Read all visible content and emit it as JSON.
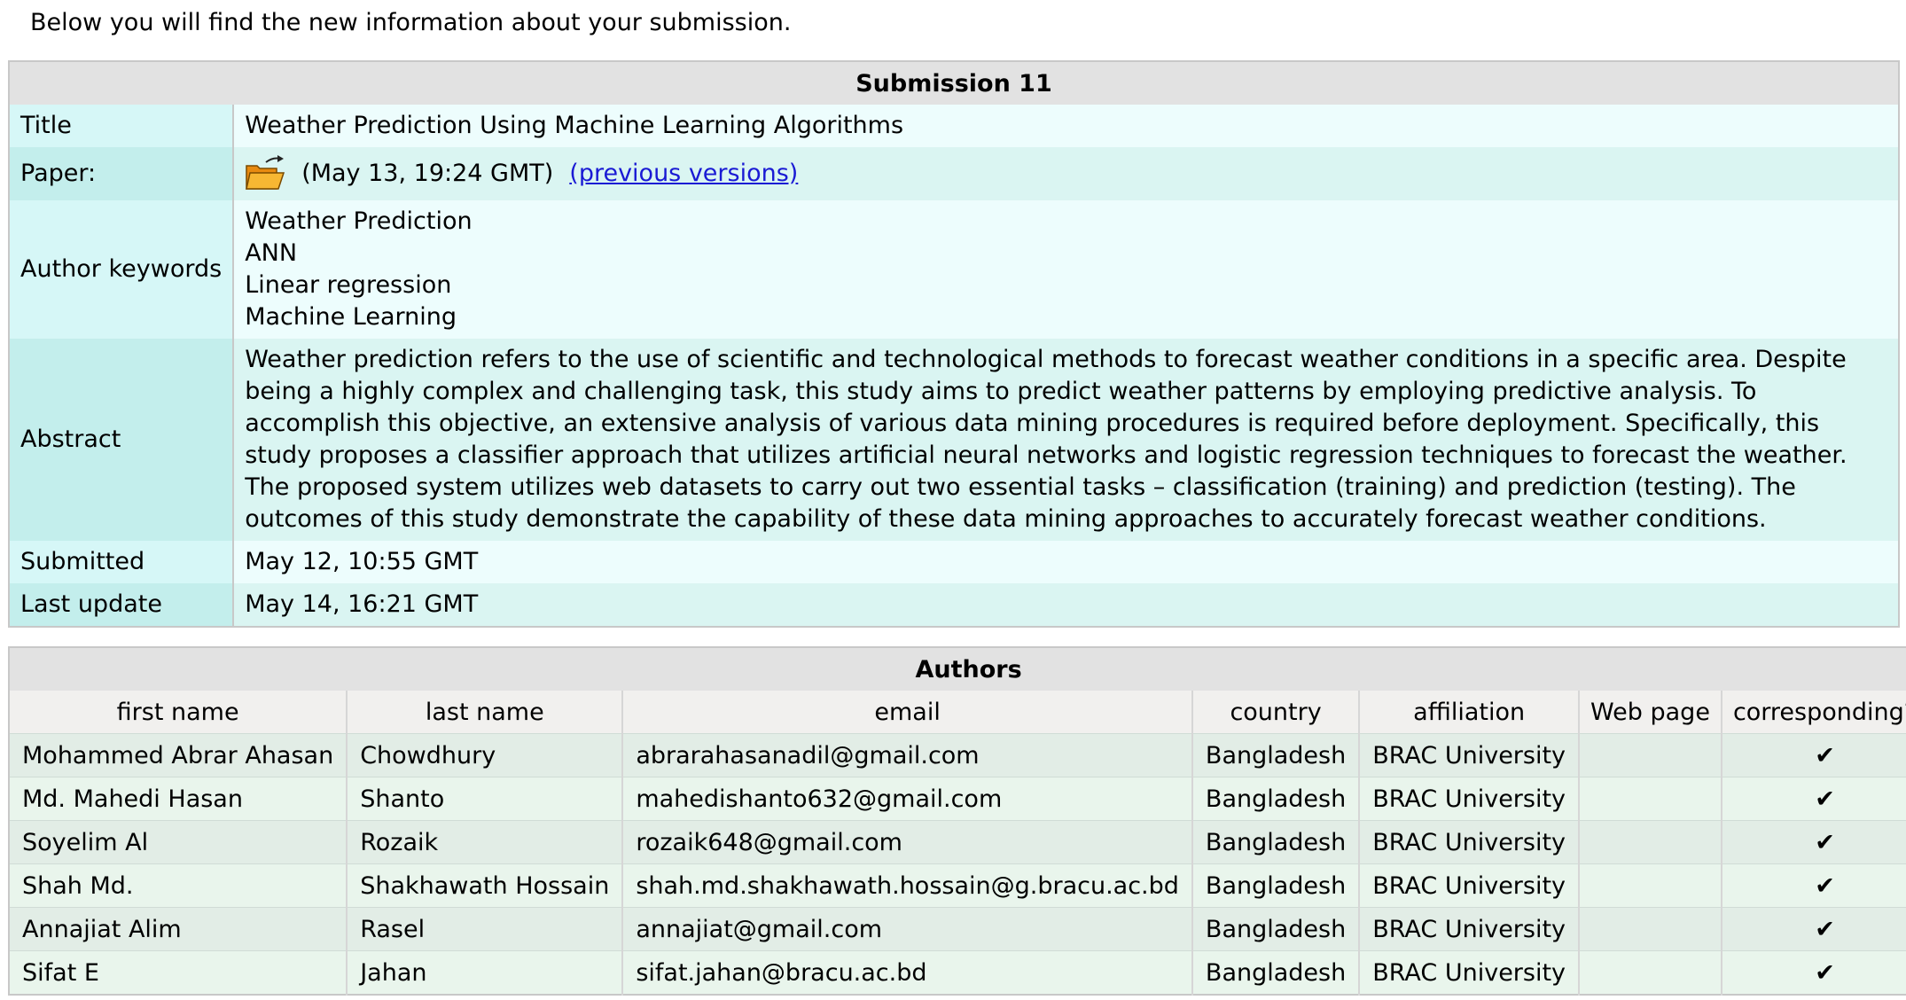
{
  "intro_text": "Below you will find the new information about your submission.",
  "submission": {
    "caption": "Submission 11",
    "title_label": "Title",
    "title_value": "Weather Prediction Using Machine Learning Algorithms",
    "paper_label": "Paper:",
    "paper_icon": "folder-open-icon",
    "paper_date": "(May 13, 19:24 GMT)",
    "paper_link": "(previous versions)",
    "keywords_label": "Author keywords",
    "keywords": [
      "Weather Prediction",
      "ANN",
      "Linear regression",
      "Machine Learning"
    ],
    "abstract_label": "Abstract",
    "abstract": "Weather prediction refers to the use of scientific and technological methods to forecast weather conditions in a specific area. Despite being a highly complex and challenging task, this study aims to predict weather patterns by employing predictive analysis. To accomplish this objective, an extensive analysis of various data mining procedures is required before deployment. Specifically, this study proposes a classifier approach that utilizes artificial neural networks and logistic regression techniques to forecast the weather. The proposed system utilizes web datasets to carry out two essential tasks – classification (training) and prediction (testing). The outcomes of this study demonstrate the capability of these data mining approaches to accurately forecast weather conditions.",
    "submitted_label": "Submitted",
    "submitted_value": "May 12, 10:55 GMT",
    "updated_label": "Last update",
    "updated_value": "May 14, 16:21 GMT"
  },
  "authors": {
    "caption": "Authors",
    "columns": [
      "first name",
      "last name",
      "email",
      "country",
      "affiliation",
      "Web page",
      "corresponding?"
    ],
    "rows": [
      [
        "Mohammed Abrar Ahasan",
        "Chowdhury",
        "abrarahasanadil@gmail.com",
        "Bangladesh",
        "BRAC University",
        "",
        "✔"
      ],
      [
        "Md. Mahedi Hasan",
        "Shanto",
        "mahedishanto632@gmail.com",
        "Bangladesh",
        "BRAC University",
        "",
        "✔"
      ],
      [
        "Soyelim Al",
        "Rozaik",
        "rozaik648@gmail.com",
        "Bangladesh",
        "BRAC University",
        "",
        "✔"
      ],
      [
        "Shah Md.",
        "Shakhawath Hossain",
        "shah.md.shakhawath.hossain@g.bracu.ac.bd",
        "Bangladesh",
        "BRAC University",
        "",
        "✔"
      ],
      [
        "Annajiat Alim",
        "Rasel",
        "annajiat@gmail.com",
        "Bangladesh",
        "BRAC University",
        "",
        "✔"
      ],
      [
        "Sifat E",
        "Jahan",
        "sifat.jahan@bracu.ac.bd",
        "Bangladesh",
        "BRAC University",
        "",
        "✔"
      ]
    ]
  },
  "colors": {
    "caption_bg": "#e2e2e2",
    "label_bg_light": "#d6f7f7",
    "label_bg_dark": "#c3eeec",
    "value_bg_light": "#edfdfd",
    "value_bg_dark": "#daf5f2",
    "link": "#1a1ad4",
    "folder": "#f5a623"
  }
}
